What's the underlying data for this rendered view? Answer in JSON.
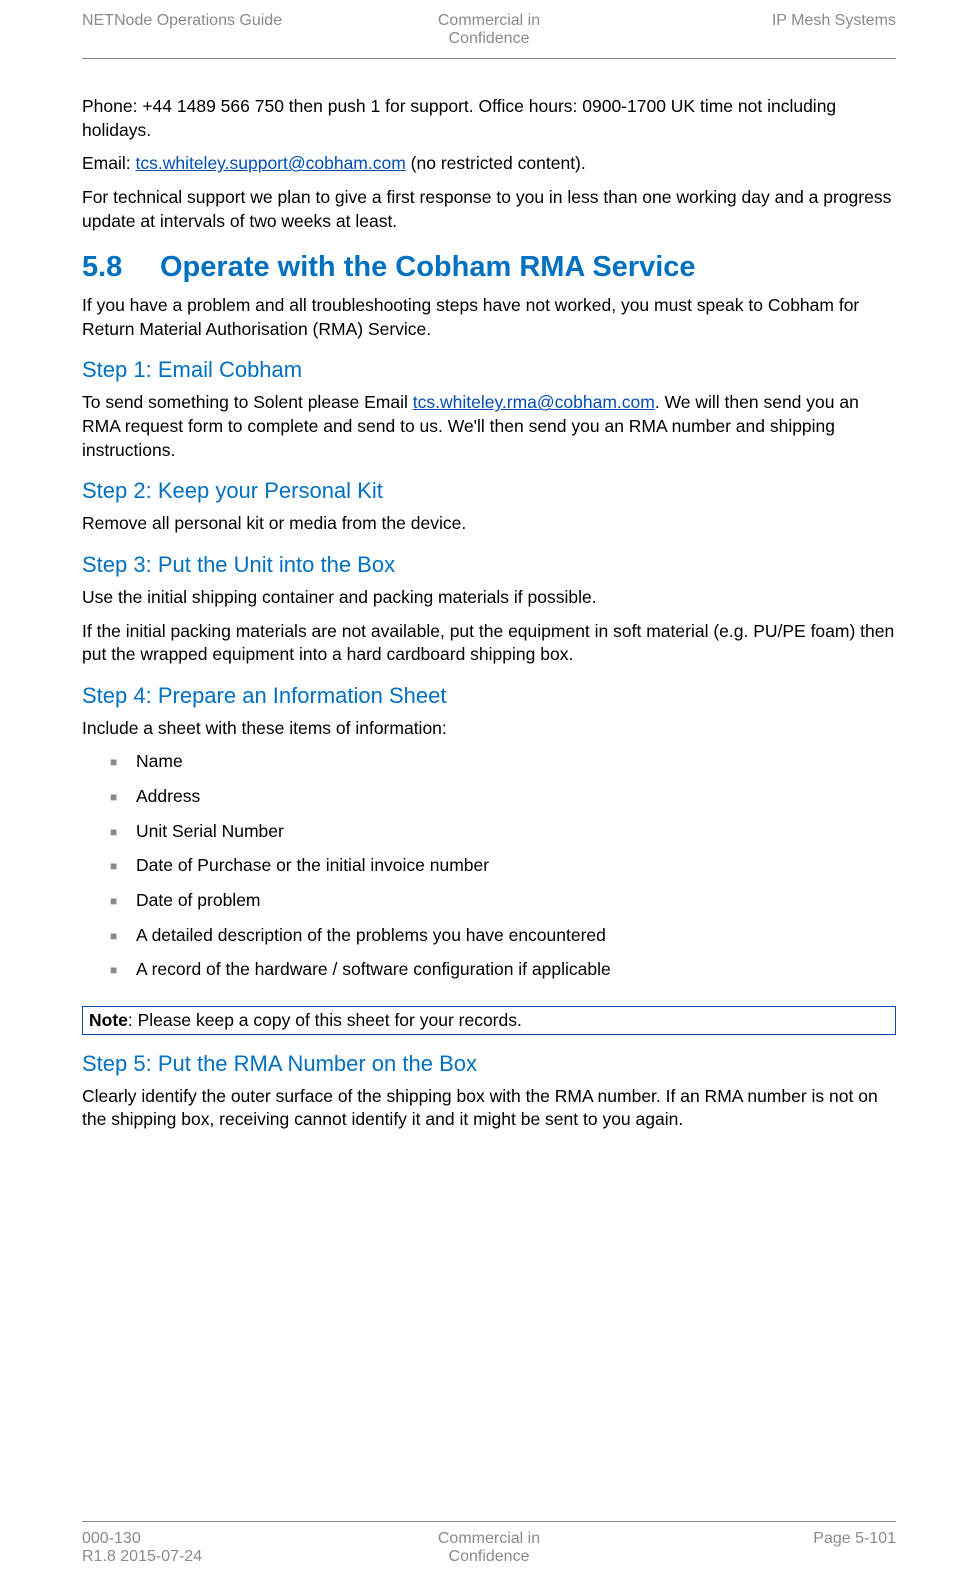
{
  "header": {
    "left": "NETNode Operations Guide",
    "center_line1": "Commercial in",
    "center_line2": "Confidence",
    "right": "IP Mesh Systems"
  },
  "intro": {
    "phone": "Phone: +44 1489 566 750 then push 1 for support. Office hours: 0900-1700 UK time not including holidays.",
    "email_prefix": "Email: ",
    "email_link": "tcs.whiteley.support@cobham.com",
    "email_suffix": " (no restricted content).",
    "support": "For technical support we plan to give a first response to you in less than one working day and a progress update at intervals of two weeks at least."
  },
  "section": {
    "number": "5.8",
    "title": "Operate with the Cobham RMA Service",
    "intro": "If you have a problem and all troubleshooting steps have not worked, you must speak to Cobham for Return Material Authorisation (RMA) Service."
  },
  "step1": {
    "title": "Step 1: Email Cobham",
    "text_prefix": "To send something to Solent please Email ",
    "email": "tcs.whiteley.rma@cobham.com",
    "text_suffix": ".  We will then send you an RMA request form to complete and send to us. We'll then send you an RMA number and shipping instructions."
  },
  "step2": {
    "title": "Step 2: Keep your Personal Kit",
    "text": "Remove all personal kit or media from the device."
  },
  "step3": {
    "title": "Step 3: Put the Unit into the Box",
    "p1": "Use the initial shipping container and packing materials if possible.",
    "p2": "If the initial packing materials are not available, put the equipment in soft material (e.g. PU/PE foam) then put the wrapped equipment into a hard cardboard shipping box."
  },
  "step4": {
    "title": "Step 4: Prepare an Information Sheet",
    "intro": "Include a sheet with these items of information:",
    "items": [
      "Name",
      "Address",
      "Unit Serial Number",
      "Date of Purchase or the initial invoice number",
      "Date of problem",
      "A detailed description of the problems you have encountered",
      "A record of the hardware / software configuration if applicable"
    ]
  },
  "note": {
    "label": "Note",
    "text": ": Please keep a copy of this sheet for your records."
  },
  "step5": {
    "title": "Step 5: Put the RMA Number on the Box",
    "text": "Clearly identify the outer surface of the shipping box with the RMA number. If an RMA number is not on the shipping box, receiving cannot identify it and it might be sent to you again."
  },
  "footer": {
    "left_line1": "000-130",
    "left_line2": "R1.8 2015-07-24",
    "center_line1": "Commercial in",
    "center_line2": "Confidence",
    "right": "Page 5-101"
  }
}
